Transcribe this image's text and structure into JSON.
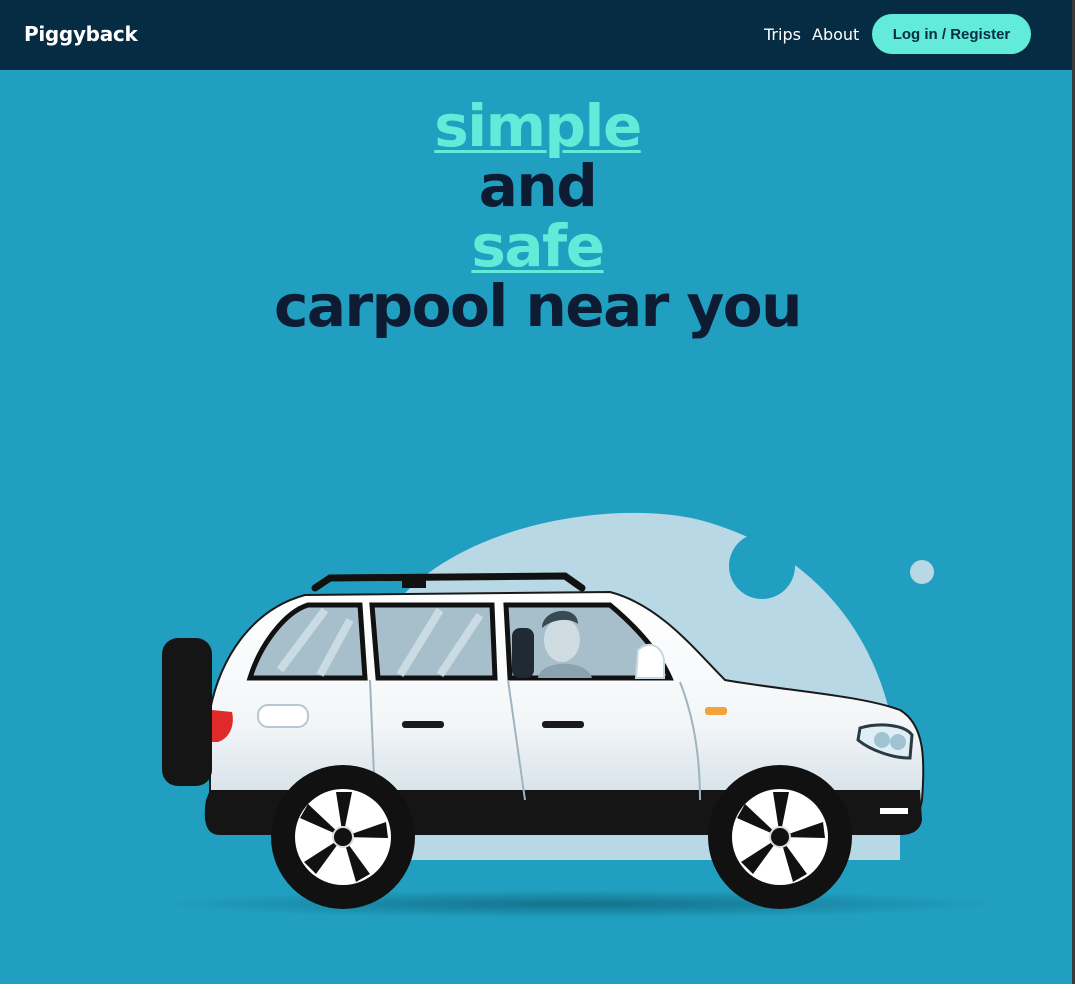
{
  "nav": {
    "brand": "Piggyback",
    "links": [
      {
        "label": "Trips"
      },
      {
        "label": "About"
      }
    ],
    "cta_label": "Log in / Register"
  },
  "hero": {
    "line1": "simple",
    "line2": "and",
    "line3": "safe",
    "line4": "carpool near you"
  },
  "colors": {
    "background": "#219fc0",
    "nav_background": "#062c44",
    "accent": "#63ebd9",
    "headline_dark": "#0d1b33"
  },
  "illustration": {
    "icon": "car-icon"
  }
}
